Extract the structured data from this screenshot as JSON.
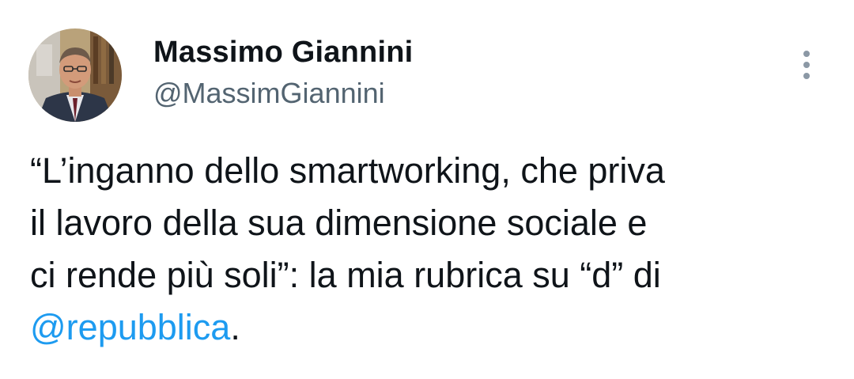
{
  "author": {
    "display_name": "Massimo Giannini",
    "handle": "@MassimGiannini",
    "avatar_icon": "profile-photo"
  },
  "menu": {
    "icon": "more-vertical-icon"
  },
  "tweet": {
    "lines": [
      "“L’inganno dello smartworking, che priva",
      "il lavoro della sua dimensione sociale e",
      "ci rende più soli”: la mia rubrica su “d” di"
    ],
    "mention": "@repubblica",
    "trailing": "."
  },
  "colors": {
    "text": "#0f1419",
    "secondary": "#536471",
    "link": "#1d9bf0"
  }
}
